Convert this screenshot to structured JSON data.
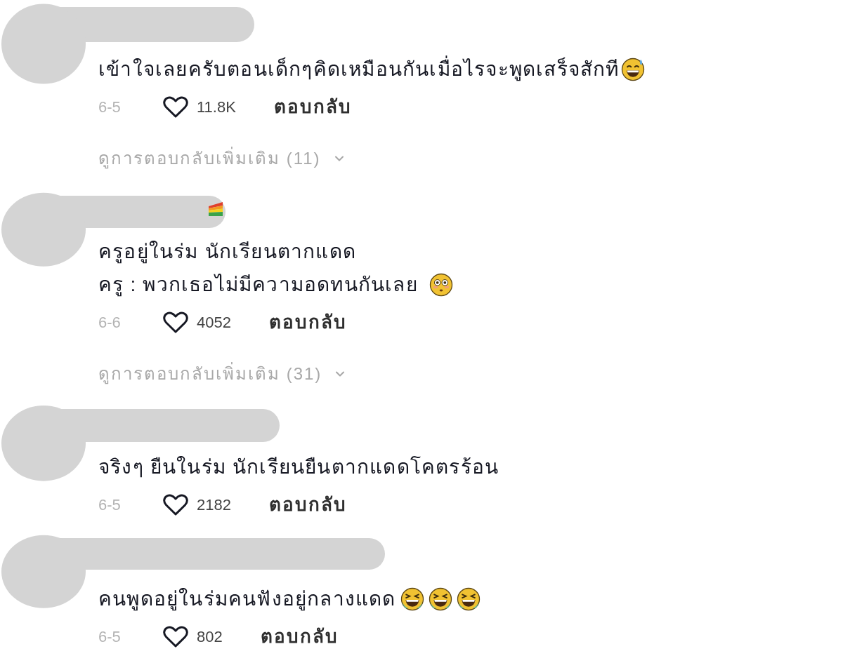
{
  "comments": [
    {
      "author": {
        "redacted": true
      },
      "lines": [
        {
          "text": "เข้าใจเลยครับตอนเด็กๆคิดเหมือนกันเมื่อไรจะพูดเสร็จสักที",
          "emojis": [
            {
              "kind": "sweat-grin"
            }
          ]
        }
      ],
      "date": "6-5",
      "liked": false,
      "likes": "11.8K",
      "reply_label": "ตอบกลับ",
      "more_replies": "ดูการตอบกลับเพิ่มเติม (11)"
    },
    {
      "author": {
        "redacted": true,
        "badges": [
          {
            "kind": "rainbow-flag"
          }
        ]
      },
      "lines": [
        {
          "text": "ครูอยู่ในร่ม นักเรียนตากแดด"
        },
        {
          "text": "ครู : พวกเธอไม่มีความอดทนกันเลย",
          "emojis": [
            {
              "kind": "flushed"
            }
          ]
        }
      ],
      "date": "6-6",
      "liked": false,
      "likes": "4052",
      "reply_label": "ตอบกลับ",
      "more_replies": "ดูการตอบกลับเพิ่มเติม (31)"
    },
    {
      "author": {
        "redacted": true
      },
      "lines": [
        {
          "text": "จริงๆ ยืนในร่ม นักเรียนยืนตากแดดโคตรร้อน"
        }
      ],
      "date": "6-5",
      "liked": false,
      "likes": "2182",
      "reply_label": "ตอบกลับ"
    },
    {
      "author": {
        "redacted": true
      },
      "lines": [
        {
          "text": "คนพูดอยู่ในร่มคนฟังอยู่กลางแดด",
          "emojis": [
            {
              "kind": "laughing"
            },
            {
              "kind": "laughing"
            },
            {
              "kind": "laughing"
            }
          ]
        }
      ],
      "date": "6-5",
      "liked": false,
      "likes": "802",
      "reply_label": "ตอบกลับ"
    }
  ]
}
